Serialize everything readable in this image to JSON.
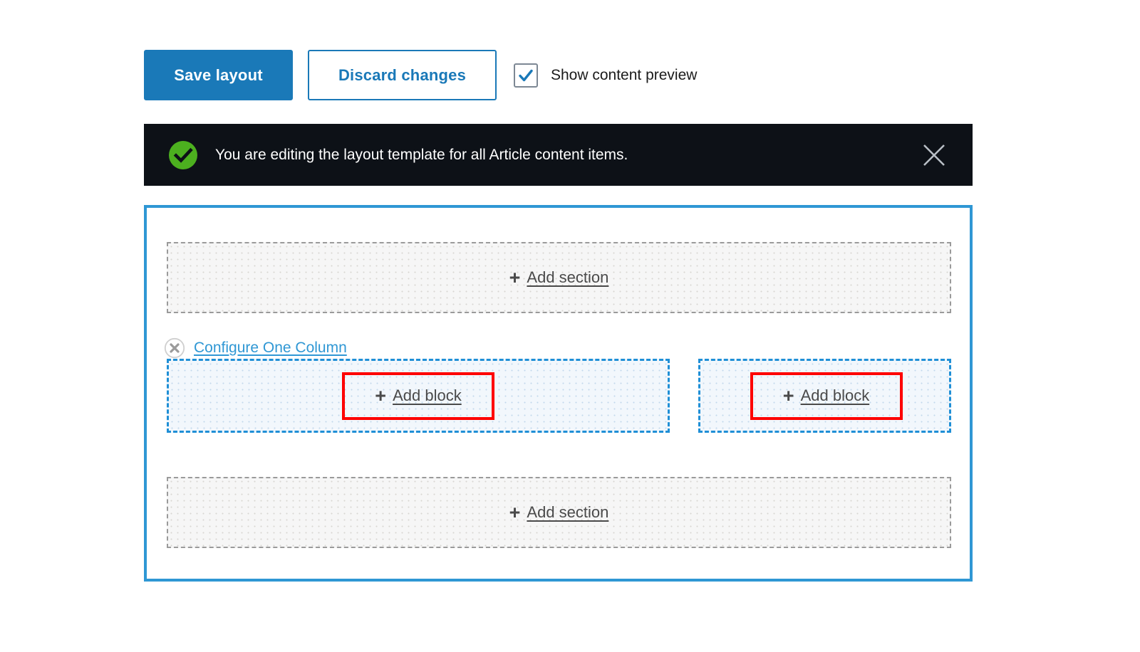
{
  "toolbar": {
    "save_label": "Save layout",
    "discard_label": "Discard changes",
    "preview_label": "Show content preview",
    "preview_checked": true,
    "checkbox_icon": "checkmark-icon"
  },
  "status": {
    "icon": "success-check-circle-icon",
    "message": "You are editing the layout template for all Article content items.",
    "close_icon": "close-icon",
    "background_color": "#0d1117",
    "icon_color": "#4cb01f"
  },
  "layout": {
    "border_color": "#2f97d4",
    "sections": {
      "top_add": {
        "plus": "+",
        "label": "Add section",
        "icon": "plus-icon"
      },
      "bottom_add": {
        "plus": "+",
        "label": "Add section",
        "icon": "plus-icon"
      }
    },
    "section_controls": {
      "remove_icon": "remove-circle-x-icon",
      "configure_label": "Configure One Column"
    },
    "regions": [
      {
        "name": "primary",
        "plus": "+",
        "label": "Add block",
        "icon": "plus-icon",
        "highlight_color": "#fe0000"
      },
      {
        "name": "secondary",
        "plus": "+",
        "label": "Add block",
        "icon": "plus-icon",
        "highlight_color": "#fe0000"
      }
    ]
  },
  "colors": {
    "primary_blue": "#1a79b8",
    "region_blue": "#1f8fd6",
    "highlight_red": "#fe0000",
    "success_green": "#4cb01f"
  }
}
